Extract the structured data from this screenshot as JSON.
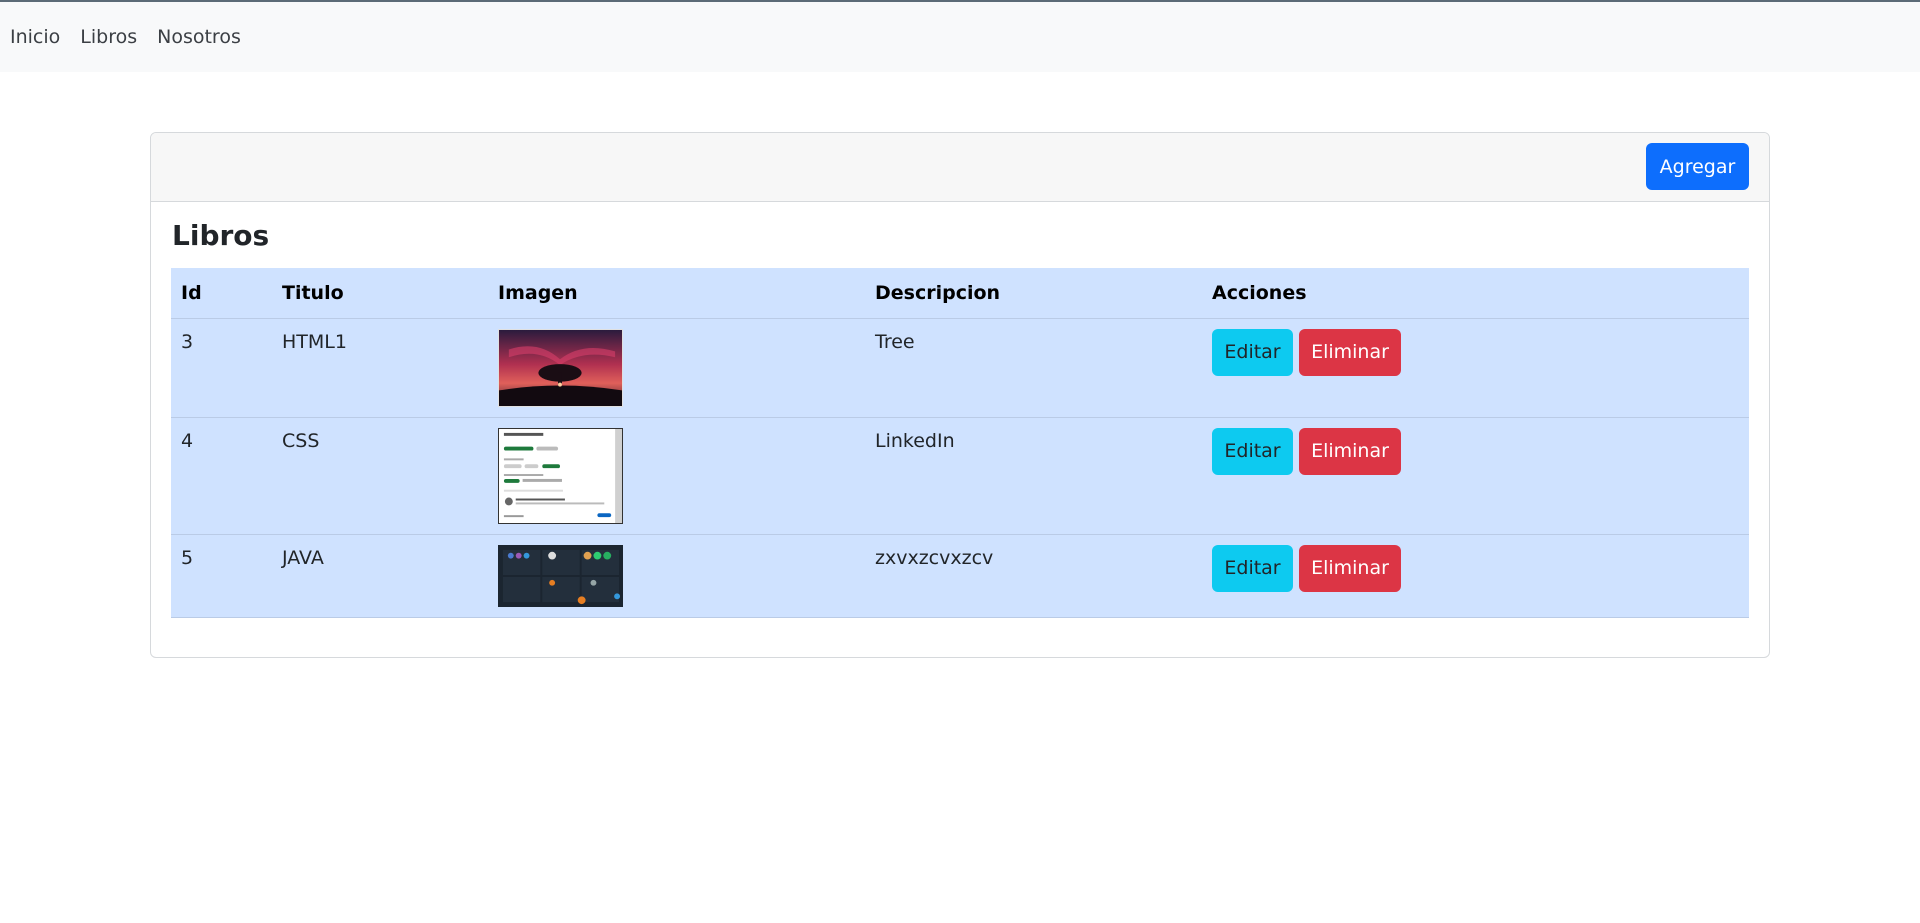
{
  "nav": {
    "items": [
      {
        "label": "Inicio"
      },
      {
        "label": "Libros"
      },
      {
        "label": "Nosotros"
      }
    ]
  },
  "card": {
    "add_label": "Agregar",
    "title": "Libros"
  },
  "table": {
    "headers": {
      "id": "Id",
      "title": "Titulo",
      "image": "Imagen",
      "description": "Descripcion",
      "actions": "Acciones"
    },
    "rows": [
      {
        "id": "3",
        "title": "HTML1",
        "description": "Tree",
        "image_icon": "sunset-tree-thumbnail",
        "edit_label": "Editar",
        "delete_label": "Eliminar"
      },
      {
        "id": "4",
        "title": "CSS",
        "description": "LinkedIn",
        "image_icon": "linkedin-screenshot-thumbnail",
        "edit_label": "Editar",
        "delete_label": "Eliminar"
      },
      {
        "id": "5",
        "title": "JAVA",
        "description": "zxvxzcvxzcv",
        "image_icon": "dark-dashboard-thumbnail",
        "edit_label": "Editar",
        "delete_label": "Eliminar"
      }
    ]
  },
  "colors": {
    "primary": "#0d6efd",
    "info": "#0dcaf0",
    "danger": "#dc3545",
    "table_bg": "#cfe2ff"
  }
}
